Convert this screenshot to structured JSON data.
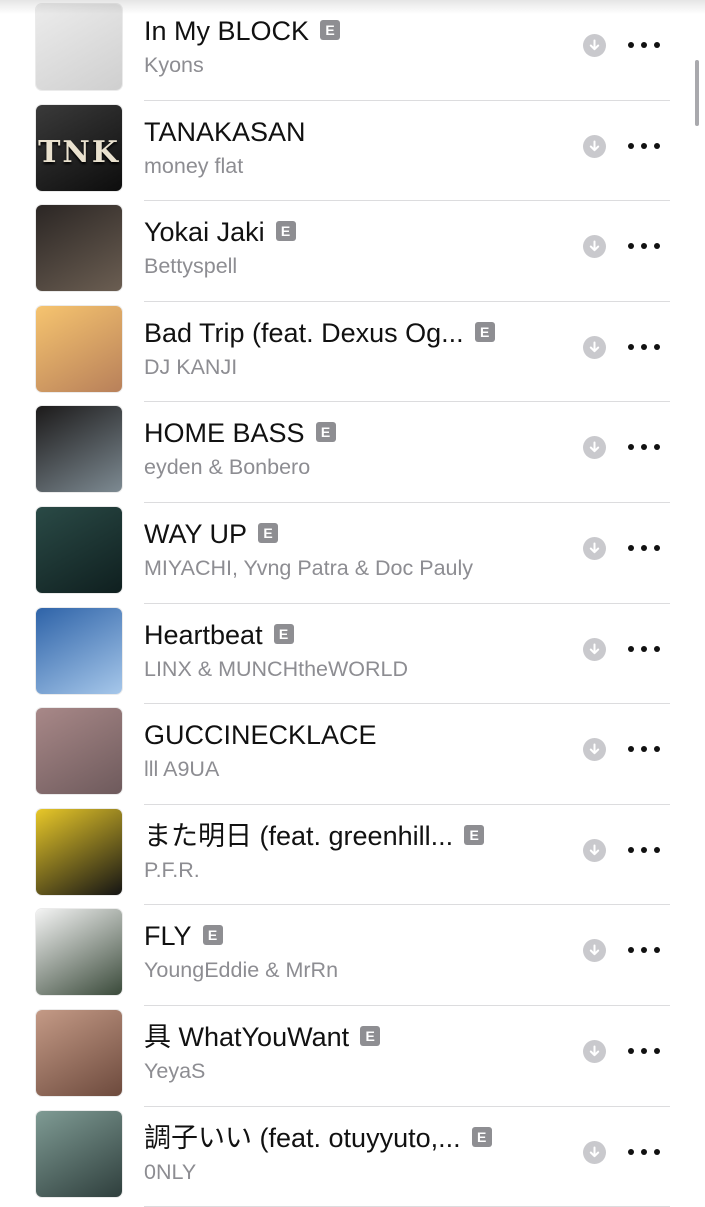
{
  "explicit_label": "E",
  "tracks": [
    {
      "title": "In My BLOCK",
      "artist": "Kyons",
      "explicit": true,
      "art_icon": "album-art-person-white-backdrop",
      "art_colors": [
        "#ececec",
        "#cfcfcf"
      ]
    },
    {
      "title": "TANAKASAN",
      "artist": "money flat",
      "explicit": false,
      "art_icon": "album-art-tnk-lettering",
      "art_label": "TNK",
      "art_colors": [
        "#3a3a3a",
        "#0d0d0d"
      ]
    },
    {
      "title": "Yokai Jaki",
      "artist": "Bettyspell",
      "explicit": true,
      "art_icon": "album-art-night-city",
      "art_colors": [
        "#2b2624",
        "#6b5e52"
      ]
    },
    {
      "title": "Bad Trip (feat. Dexus Og...",
      "artist": "DJ KANJI",
      "explicit": true,
      "art_icon": "album-art-golden-heart",
      "art_colors": [
        "#f6c46f",
        "#b8805a"
      ]
    },
    {
      "title": "HOME BASS",
      "artist": "eyden & Bonbero",
      "explicit": true,
      "art_icon": "album-art-two-people",
      "art_colors": [
        "#1c1a1a",
        "#7d8a92"
      ]
    },
    {
      "title": "WAY UP",
      "artist": "MIYACHI, Yvng Patra & Doc Pauly",
      "explicit": true,
      "art_icon": "album-art-ufo",
      "art_colors": [
        "#2a4a46",
        "#0f1f1f"
      ]
    },
    {
      "title": "Heartbeat",
      "artist": "LINX & MUNCHtheWORLD",
      "explicit": true,
      "art_icon": "album-art-winged-heart",
      "art_colors": [
        "#2e63a8",
        "#a6c7ea"
      ]
    },
    {
      "title": "GUCCINECKLACE",
      "artist": "lll A9UA",
      "explicit": false,
      "art_icon": "album-art-necklace",
      "art_colors": [
        "#a88888",
        "#6e5a5c"
      ]
    },
    {
      "title": "また明日 (feat. greenhill...",
      "artist": "P.F.R.",
      "explicit": true,
      "art_icon": "album-art-group-photo",
      "art_colors": [
        "#e8c829",
        "#141414"
      ]
    },
    {
      "title": "FLY",
      "artist": "YoungEddie & MrRn",
      "explicit": true,
      "art_icon": "album-art-collage",
      "art_colors": [
        "#f4f4f4",
        "#3a4a3a"
      ]
    },
    {
      "title": "具 WhatYouWant",
      "artist": "YeyaS",
      "explicit": true,
      "art_icon": "album-art-tattoo",
      "art_colors": [
        "#c49a86",
        "#6d4a3d"
      ]
    },
    {
      "title": "調子いい (feat. otuyyuto,...",
      "artist": "0NLY",
      "explicit": true,
      "art_icon": "album-art-glow-in-the-void",
      "art_colors": [
        "#7f9b94",
        "#2f3f3d"
      ]
    }
  ],
  "icons": {
    "download": "download-circle-icon",
    "more": "more-ellipsis-icon"
  }
}
